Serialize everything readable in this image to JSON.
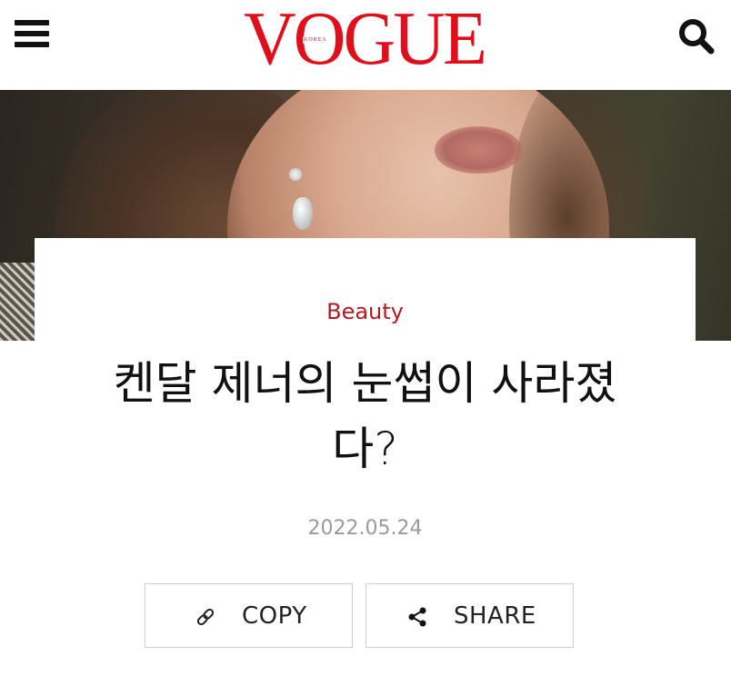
{
  "header": {
    "logo_text": "VOGUE",
    "logo_subtext": "KOREA"
  },
  "article": {
    "category": "Beauty",
    "title": "켄달 제너의 눈썹이 사라졌다?",
    "date": "2022.05.24"
  },
  "actions": {
    "copy_label": "COPY",
    "share_label": "SHARE"
  },
  "colors": {
    "brand_red": "#e10f1c",
    "category_red": "#b8181f",
    "date_gray": "#9a9a9a"
  },
  "icons": {
    "menu": "hamburger-menu-icon",
    "search": "search-icon",
    "copy": "link-icon",
    "share": "share-icon"
  }
}
